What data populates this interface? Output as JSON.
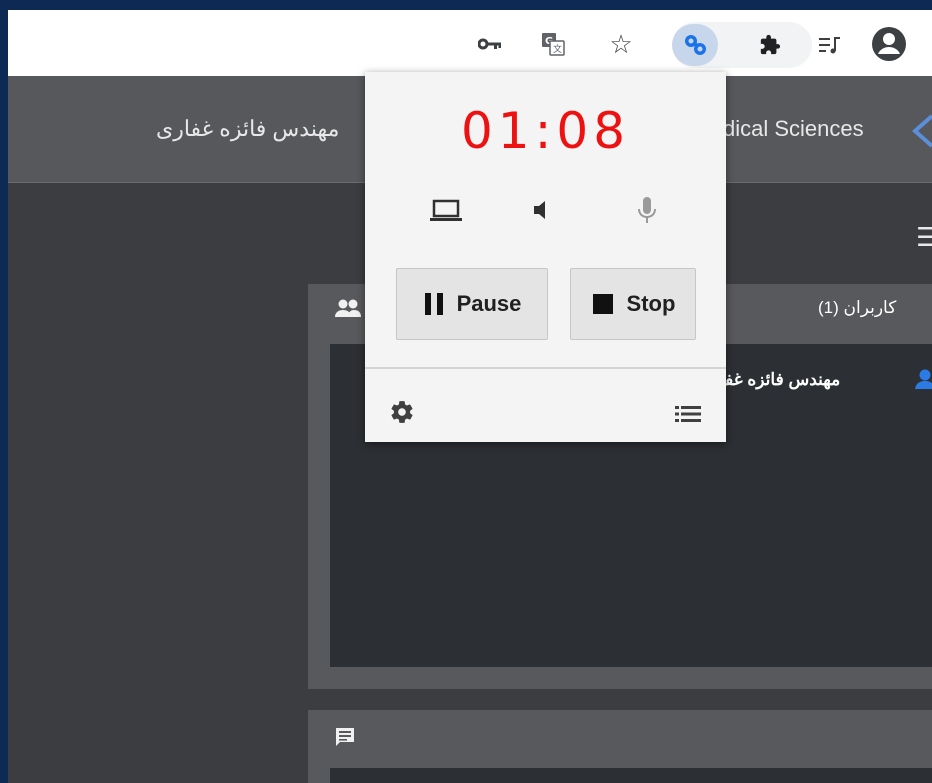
{
  "toolbar": {
    "icons": [
      "key-icon",
      "translate-icon",
      "star-icon",
      "screen-recorder-extension-icon",
      "extensions-puzzle-icon",
      "media-queue-icon",
      "profile-icon"
    ]
  },
  "header": {
    "left_title": "مهندس فائزه غفاری",
    "right_title": "dical Sciences"
  },
  "users_panel": {
    "title": "کاربران (1)",
    "user_name": "مهندس فائزه غفا"
  },
  "recorder": {
    "time": "01:08",
    "pause_label": "Pause",
    "stop_label": "Stop",
    "timer_color": "#ee1111"
  }
}
